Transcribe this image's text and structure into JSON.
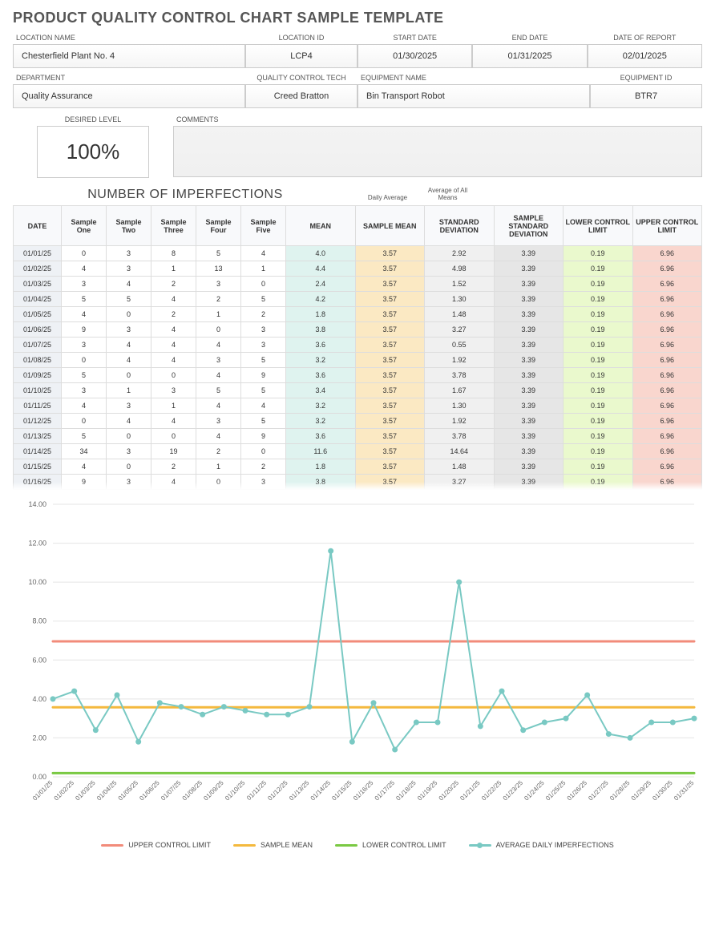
{
  "title": "PRODUCT QUALITY CONTROL CHART SAMPLE TEMPLATE",
  "meta": {
    "row1": {
      "location_name_label": "LOCATION NAME",
      "location_name": "Chesterfield Plant No. 4",
      "location_id_label": "LOCATION ID",
      "location_id": "LCP4",
      "start_date_label": "START DATE",
      "start_date": "01/30/2025",
      "end_date_label": "END DATE",
      "end_date": "01/31/2025",
      "report_date_label": "DATE OF REPORT",
      "report_date": "02/01/2025"
    },
    "row2": {
      "department_label": "DEPARTMENT",
      "department": "Quality Assurance",
      "qc_tech_label": "QUALITY CONTROL TECH",
      "qc_tech": "Creed Bratton",
      "equipment_name_label": "EQUIPMENT NAME",
      "equipment_name": "Bin Transport Robot",
      "equipment_id_label": "EQUIPMENT ID",
      "equipment_id": "BTR7"
    },
    "row3": {
      "desired_label": "DESIRED LEVEL",
      "desired_value": "100%",
      "comments_label": "COMMENTS"
    }
  },
  "section": {
    "title": "NUMBER OF IMPERFECTIONS",
    "note1": "Daily Average",
    "note2": "Average of All Means"
  },
  "headers": {
    "date": "DATE",
    "s1": "Sample One",
    "s2": "Sample Two",
    "s3": "Sample Three",
    "s4": "Sample Four",
    "s5": "Sample Five",
    "mean": "MEAN",
    "smean": "SAMPLE MEAN",
    "std": "STANDARD DEVIATION",
    "sstd": "SAMPLE STANDARD DEVIATION",
    "lcl": "LOWER CONTROL LIMIT",
    "ucl": "UPPER CONTROL LIMIT"
  },
  "rows": [
    {
      "date": "01/01/25",
      "s": [
        0,
        3,
        8,
        5,
        4
      ],
      "mean": 4.0,
      "smean": 3.57,
      "std": 2.92,
      "sstd": 3.39,
      "lcl": 0.19,
      "ucl": 6.96
    },
    {
      "date": "01/02/25",
      "s": [
        4,
        3,
        1,
        13,
        1
      ],
      "mean": 4.4,
      "smean": 3.57,
      "std": 4.98,
      "sstd": 3.39,
      "lcl": 0.19,
      "ucl": 6.96
    },
    {
      "date": "01/03/25",
      "s": [
        3,
        4,
        2,
        3,
        0
      ],
      "mean": 2.4,
      "smean": 3.57,
      "std": 1.52,
      "sstd": 3.39,
      "lcl": 0.19,
      "ucl": 6.96
    },
    {
      "date": "01/04/25",
      "s": [
        5,
        5,
        4,
        2,
        5
      ],
      "mean": 4.2,
      "smean": 3.57,
      "std": 1.3,
      "sstd": 3.39,
      "lcl": 0.19,
      "ucl": 6.96
    },
    {
      "date": "01/05/25",
      "s": [
        4,
        0,
        2,
        1,
        2
      ],
      "mean": 1.8,
      "smean": 3.57,
      "std": 1.48,
      "sstd": 3.39,
      "lcl": 0.19,
      "ucl": 6.96
    },
    {
      "date": "01/06/25",
      "s": [
        9,
        3,
        4,
        0,
        3
      ],
      "mean": 3.8,
      "smean": 3.57,
      "std": 3.27,
      "sstd": 3.39,
      "lcl": 0.19,
      "ucl": 6.96
    },
    {
      "date": "01/07/25",
      "s": [
        3,
        4,
        4,
        4,
        3
      ],
      "mean": 3.6,
      "smean": 3.57,
      "std": 0.55,
      "sstd": 3.39,
      "lcl": 0.19,
      "ucl": 6.96
    },
    {
      "date": "01/08/25",
      "s": [
        0,
        4,
        4,
        3,
        5
      ],
      "mean": 3.2,
      "smean": 3.57,
      "std": 1.92,
      "sstd": 3.39,
      "lcl": 0.19,
      "ucl": 6.96
    },
    {
      "date": "01/09/25",
      "s": [
        5,
        0,
        0,
        4,
        9
      ],
      "mean": 3.6,
      "smean": 3.57,
      "std": 3.78,
      "sstd": 3.39,
      "lcl": 0.19,
      "ucl": 6.96
    },
    {
      "date": "01/10/25",
      "s": [
        3,
        1,
        3,
        5,
        5
      ],
      "mean": 3.4,
      "smean": 3.57,
      "std": 1.67,
      "sstd": 3.39,
      "lcl": 0.19,
      "ucl": 6.96
    },
    {
      "date": "01/11/25",
      "s": [
        4,
        3,
        1,
        4,
        4
      ],
      "mean": 3.2,
      "smean": 3.57,
      "std": 1.3,
      "sstd": 3.39,
      "lcl": 0.19,
      "ucl": 6.96
    },
    {
      "date": "01/12/25",
      "s": [
        0,
        4,
        4,
        3,
        5
      ],
      "mean": 3.2,
      "smean": 3.57,
      "std": 1.92,
      "sstd": 3.39,
      "lcl": 0.19,
      "ucl": 6.96
    },
    {
      "date": "01/13/25",
      "s": [
        5,
        0,
        0,
        4,
        9
      ],
      "mean": 3.6,
      "smean": 3.57,
      "std": 3.78,
      "sstd": 3.39,
      "lcl": 0.19,
      "ucl": 6.96
    },
    {
      "date": "01/14/25",
      "s": [
        34,
        3,
        19,
        2,
        0
      ],
      "mean": 11.6,
      "smean": 3.57,
      "std": 14.64,
      "sstd": 3.39,
      "lcl": 0.19,
      "ucl": 6.96
    },
    {
      "date": "01/15/25",
      "s": [
        4,
        0,
        2,
        1,
        2
      ],
      "mean": 1.8,
      "smean": 3.57,
      "std": 1.48,
      "sstd": 3.39,
      "lcl": 0.19,
      "ucl": 6.96
    },
    {
      "date": "01/16/25",
      "s": [
        9,
        3,
        4,
        0,
        3
      ],
      "mean": 3.8,
      "smean": 3.57,
      "std": 3.27,
      "sstd": 3.39,
      "lcl": 0.19,
      "ucl": 6.96
    }
  ],
  "legend": {
    "ucl": "UPPER CONTROL LIMIT",
    "smean": "SAMPLE MEAN",
    "lcl": "LOWER CONTROL LIMIT",
    "avg": "AVERAGE DAILY IMPERFECTIONS"
  },
  "chart_data": {
    "type": "line",
    "title": "",
    "xlabel": "",
    "ylabel": "",
    "ylim": [
      0,
      14
    ],
    "yticks": [
      0,
      2,
      4,
      6,
      8,
      10,
      12,
      14
    ],
    "categories": [
      "01/01/25",
      "01/02/25",
      "01/03/25",
      "01/04/25",
      "01/05/25",
      "01/06/25",
      "01/07/25",
      "01/08/25",
      "01/09/25",
      "01/10/25",
      "01/11/25",
      "01/12/25",
      "01/13/25",
      "01/14/25",
      "01/15/25",
      "01/16/25",
      "01/17/25",
      "01/18/25",
      "01/19/25",
      "01/20/25",
      "01/21/25",
      "01/22/25",
      "01/23/25",
      "01/24/25",
      "01/25/25",
      "01/26/25",
      "01/27/25",
      "01/28/25",
      "01/29/25",
      "01/30/25",
      "01/31/25"
    ],
    "series": [
      {
        "name": "UPPER CONTROL LIMIT",
        "color": "#f28b7a",
        "style": "flat",
        "value": 6.96
      },
      {
        "name": "SAMPLE MEAN",
        "color": "#f4b93e",
        "style": "flat",
        "value": 3.57
      },
      {
        "name": "LOWER CONTROL LIMIT",
        "color": "#7ac943",
        "style": "flat",
        "value": 0.19
      },
      {
        "name": "AVERAGE DAILY IMPERFECTIONS",
        "color": "#79c9c3",
        "style": "line-dot",
        "values": [
          4.0,
          4.4,
          2.4,
          4.2,
          1.8,
          3.8,
          3.6,
          3.2,
          3.6,
          3.4,
          3.2,
          3.2,
          3.6,
          11.6,
          1.8,
          3.8,
          1.4,
          2.8,
          2.8,
          10.0,
          2.6,
          4.4,
          2.4,
          2.8,
          3.0,
          4.2,
          2.2,
          2.0,
          2.8,
          2.8,
          3.0
        ]
      }
    ]
  },
  "colors": {
    "ucl": "#f28b7a",
    "smean": "#f4b93e",
    "lcl": "#7ac943",
    "line": "#79c9c3"
  }
}
